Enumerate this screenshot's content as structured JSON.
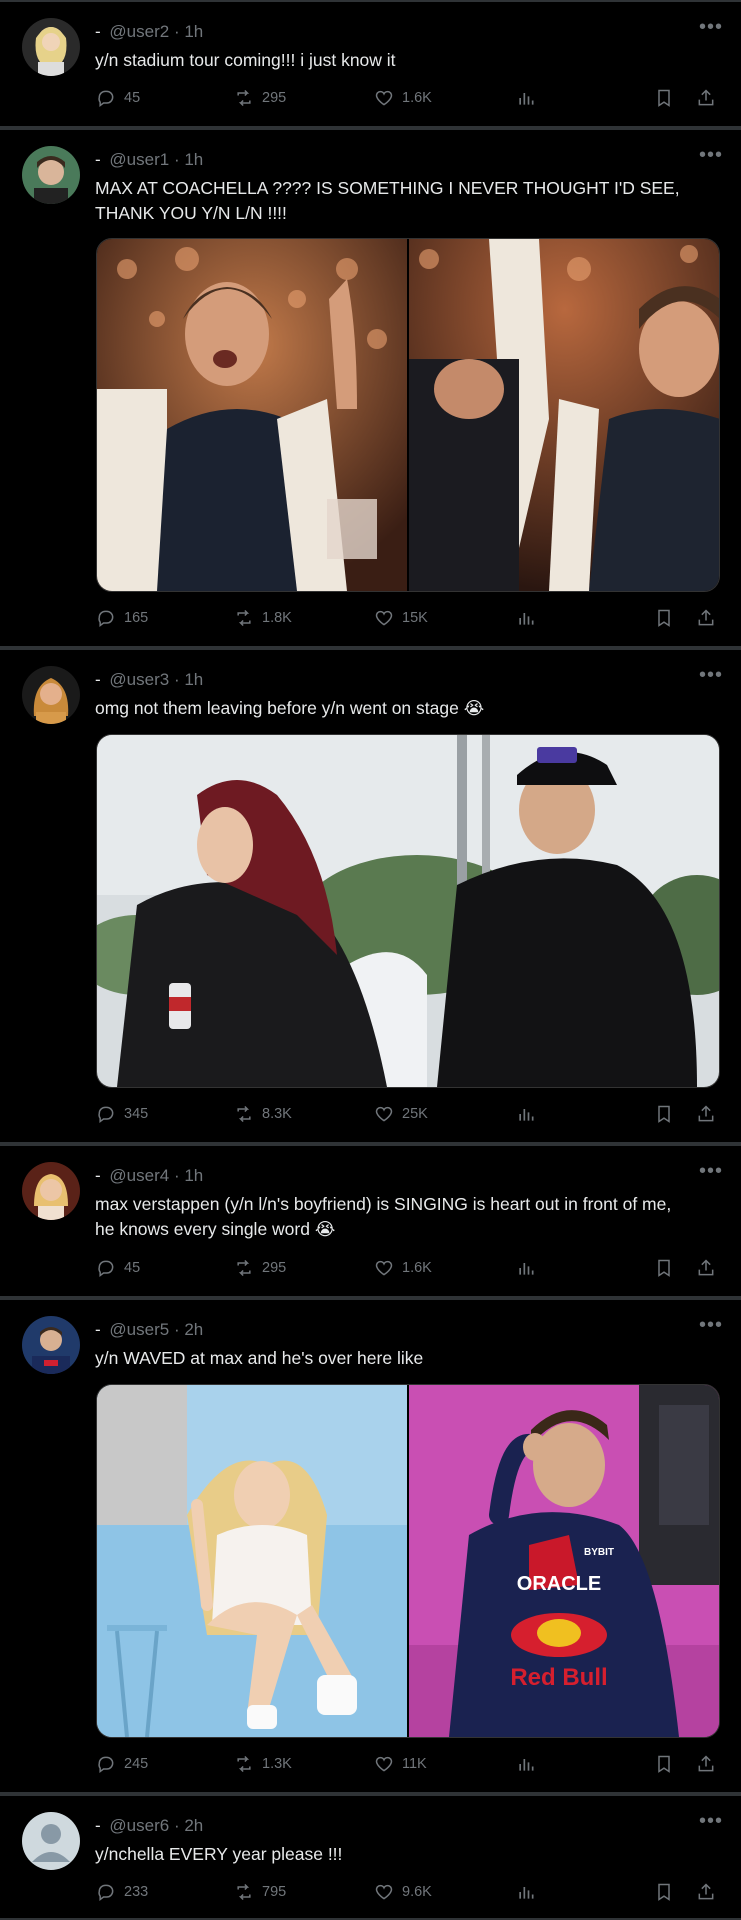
{
  "colors": {
    "background": "#000000",
    "text": "#e7e9ea",
    "muted": "#71767b",
    "divider": "#2f3336"
  },
  "posts": [
    {
      "dash": "-",
      "handle": "@user2",
      "time": "· 1h",
      "lines": [
        "y/n stadium tour coming!!! i just know it"
      ],
      "replies": "45",
      "reposts": "295",
      "likes": "1.6K"
    },
    {
      "dash": "-",
      "handle": "@user1",
      "time": "· 1h",
      "lines": [
        "MAX AT COACHELLA ???? IS SOMETHING I NEVER THOUGHT I'D SEE,",
        "THANK YOU Y/N L/N !!!!"
      ],
      "replies": "165",
      "reposts": "1.8K",
      "likes": "15K"
    },
    {
      "dash": "-",
      "handle": "@user3",
      "time": "· 1h",
      "lines": [
        "omg not them leaving before y/n went on stage 😭"
      ],
      "replies": "345",
      "reposts": "8.3K",
      "likes": "25K"
    },
    {
      "dash": "-",
      "handle": "@user4",
      "time": "· 1h",
      "lines": [
        "max verstappen (y/n l/n's boyfriend) is SINGING is heart out in front of me,",
        "he knows every single word 😭"
      ],
      "replies": "45",
      "reposts": "295",
      "likes": "1.6K"
    },
    {
      "dash": "-",
      "handle": "@user5",
      "time": "· 2h",
      "lines": [
        "y/n WAVED at max and he's over here like"
      ],
      "replies": "245",
      "reposts": "1.3K",
      "likes": "11K"
    },
    {
      "dash": "-",
      "handle": "@user6",
      "time": "· 2h",
      "lines": [
        "y/nchella EVERY year please !!!"
      ],
      "replies": "233",
      "reposts": "795",
      "likes": "9.6K"
    }
  ],
  "icons": [
    "more-icon",
    "reply-icon",
    "repost-icon",
    "like-icon",
    "views-icon",
    "bookmark-icon",
    "share-icon"
  ],
  "media": {
    "jersey_text_1": "ORACLE",
    "jersey_text_2": "Red Bull",
    "jersey_text_3": "BYBIT"
  }
}
